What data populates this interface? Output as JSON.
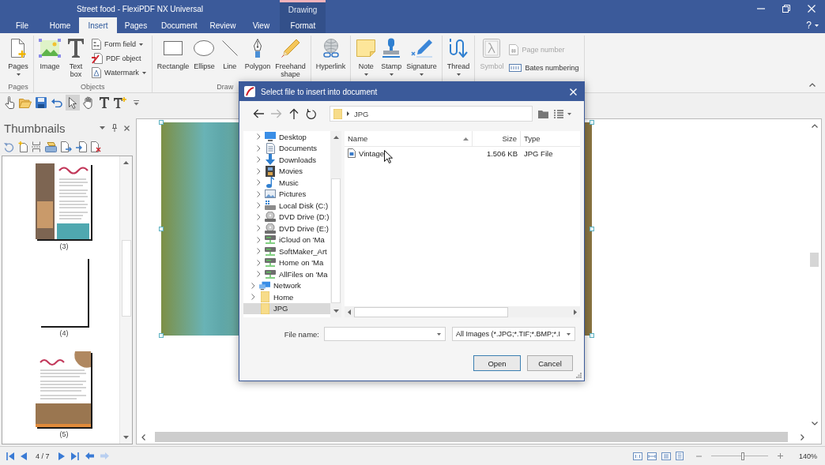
{
  "window": {
    "title": "Street food - FlexiPDF NX Universal",
    "context_group": "Drawing"
  },
  "tabs": [
    {
      "label": "File",
      "selected": false,
      "contextual": false
    },
    {
      "label": "Home",
      "selected": false,
      "contextual": false
    },
    {
      "label": "Insert",
      "selected": true,
      "contextual": false
    },
    {
      "label": "Pages",
      "selected": false,
      "contextual": false
    },
    {
      "label": "Document",
      "selected": false,
      "contextual": false
    },
    {
      "label": "Review",
      "selected": false,
      "contextual": false
    },
    {
      "label": "View",
      "selected": false,
      "contextual": false
    },
    {
      "label": "Format",
      "selected": false,
      "contextual": true
    }
  ],
  "help": "?",
  "ribbon": {
    "groups": [
      {
        "label": "Pages",
        "items": [
          {
            "kind": "large",
            "label": "Pages",
            "dropdown": true,
            "disabled": false
          }
        ]
      },
      {
        "label": "Objects",
        "items": [
          {
            "kind": "large",
            "label": "Image",
            "dropdown": false,
            "disabled": false
          },
          {
            "kind": "large",
            "label": "Text box",
            "dropdown": false,
            "disabled": false
          },
          {
            "kind": "stack",
            "entries": [
              {
                "label": "Form field",
                "dropdown": true,
                "disabled": false
              },
              {
                "label": "PDF object",
                "dropdown": false,
                "disabled": false
              },
              {
                "label": "Watermark",
                "dropdown": true,
                "disabled": false
              }
            ]
          }
        ]
      },
      {
        "label": "Draw",
        "items": [
          {
            "kind": "large",
            "label": "Rectangle",
            "dropdown": false,
            "disabled": false
          },
          {
            "kind": "large",
            "label": "Ellipse",
            "dropdown": false,
            "disabled": false
          },
          {
            "kind": "large",
            "label": "Line",
            "dropdown": false,
            "disabled": false
          },
          {
            "kind": "large",
            "label": "Polygon",
            "dropdown": false,
            "disabled": false
          },
          {
            "kind": "large",
            "label": "Freehand shape",
            "dropdown": false,
            "disabled": false
          }
        ]
      },
      {
        "items": [
          {
            "kind": "large",
            "label": "Hyperlink",
            "dropdown": false,
            "disabled": false
          }
        ]
      },
      {
        "items": [
          {
            "kind": "large",
            "label": "Note",
            "dropdown": true,
            "disabled": false
          },
          {
            "kind": "large",
            "label": "Stamp",
            "dropdown": true,
            "disabled": false
          },
          {
            "kind": "large",
            "label": "Signature",
            "dropdown": true,
            "disabled": false
          }
        ]
      },
      {
        "items": [
          {
            "kind": "large",
            "label": "Thread",
            "dropdown": true,
            "disabled": false
          }
        ]
      },
      {
        "items": [
          {
            "kind": "large",
            "label": "Symbol",
            "dropdown": false,
            "disabled": true
          },
          {
            "kind": "stack",
            "entries": [
              {
                "label": "Page number",
                "dropdown": false,
                "disabled": true
              },
              {
                "label": "Bates numbering",
                "dropdown": false,
                "disabled": false
              }
            ]
          }
        ]
      }
    ]
  },
  "quick_access": {
    "tools": [
      {
        "selected": true
      },
      {
        "selected": false
      },
      {
        "selected": false
      },
      {
        "selected": false
      }
    ]
  },
  "thumbnails": {
    "title": "Thumbnails",
    "pages": [
      {
        "label": "(3)",
        "kind": "sidebar"
      },
      {
        "label": "(4)",
        "kind": "blank"
      },
      {
        "label": "(5)",
        "kind": "banner"
      }
    ]
  },
  "document": {
    "image_selected": true
  },
  "status_bar": {
    "page": "4 / 7",
    "history": [
      {
        "disabled": false
      },
      {
        "disabled": true
      }
    ]
  },
  "zoom": {
    "level": 0.56,
    "reading": "140%"
  },
  "dialog": {
    "title": "Select file to insert into document",
    "nav": [
      {
        "disabled": false
      },
      {
        "disabled": true
      },
      {
        "disabled": false
      },
      {
        "disabled": false
      }
    ],
    "path": [
      "JPG"
    ],
    "tree": {
      "items": [
        {
          "children": [
            {
              "label": "Desktop",
              "kind": "desktop",
              "expandable": true,
              "selected": false
            },
            {
              "label": "Documents",
              "kind": "documents",
              "expandable": true,
              "selected": false
            },
            {
              "label": "Downloads",
              "kind": "downloads",
              "expandable": true,
              "selected": false
            },
            {
              "label": "Movies",
              "kind": "movies",
              "expandable": true,
              "selected": false
            },
            {
              "label": "Music",
              "kind": "music",
              "expandable": true,
              "selected": false
            },
            {
              "label": "Pictures",
              "kind": "pictures",
              "expandable": true,
              "selected": false
            },
            {
              "label": "Local Disk (C:)",
              "kind": "disk",
              "expandable": true,
              "selected": false
            },
            {
              "label": "DVD Drive (D:)",
              "kind": "dvd",
              "expandable": true,
              "selected": false
            },
            {
              "label": "DVD Drive (E:)",
              "kind": "dvd",
              "expandable": true,
              "selected": false
            },
            {
              "label": "iCloud on 'Ma",
              "kind": "share",
              "expandable": true,
              "selected": false
            },
            {
              "label": "SoftMaker_Art",
              "kind": "share",
              "expandable": true,
              "selected": false
            },
            {
              "label": "Home on 'Ma",
              "kind": "share",
              "expandable": true,
              "selected": false
            },
            {
              "label": "AllFiles on 'Ma",
              "kind": "share",
              "expandable": true,
              "selected": false
            }
          ]
        },
        {
          "label": "Network",
          "kind": "network",
          "expandable": true,
          "selected": false
        },
        {
          "label": "Home",
          "kind": "folder",
          "expandable": true,
          "selected": false
        },
        {
          "label": "JPG",
          "kind": "folder",
          "expandable": false,
          "selected": true
        }
      ]
    },
    "columns": [
      {
        "label": "Name",
        "sorted": true
      },
      {
        "label": "Size",
        "sorted": false
      },
      {
        "label": "Type",
        "sorted": false
      }
    ],
    "files": [
      {
        "name": "Vintage",
        "size": "1.506 KB",
        "type": "JPG File"
      }
    ],
    "file_name_label": "File name:",
    "file_type": "All Images (*.JPG;*.TIF;*.BMP;*.I",
    "buttons": [
      {
        "label": "Open",
        "default": true
      },
      {
        "label": "Cancel",
        "default": false
      }
    ]
  }
}
